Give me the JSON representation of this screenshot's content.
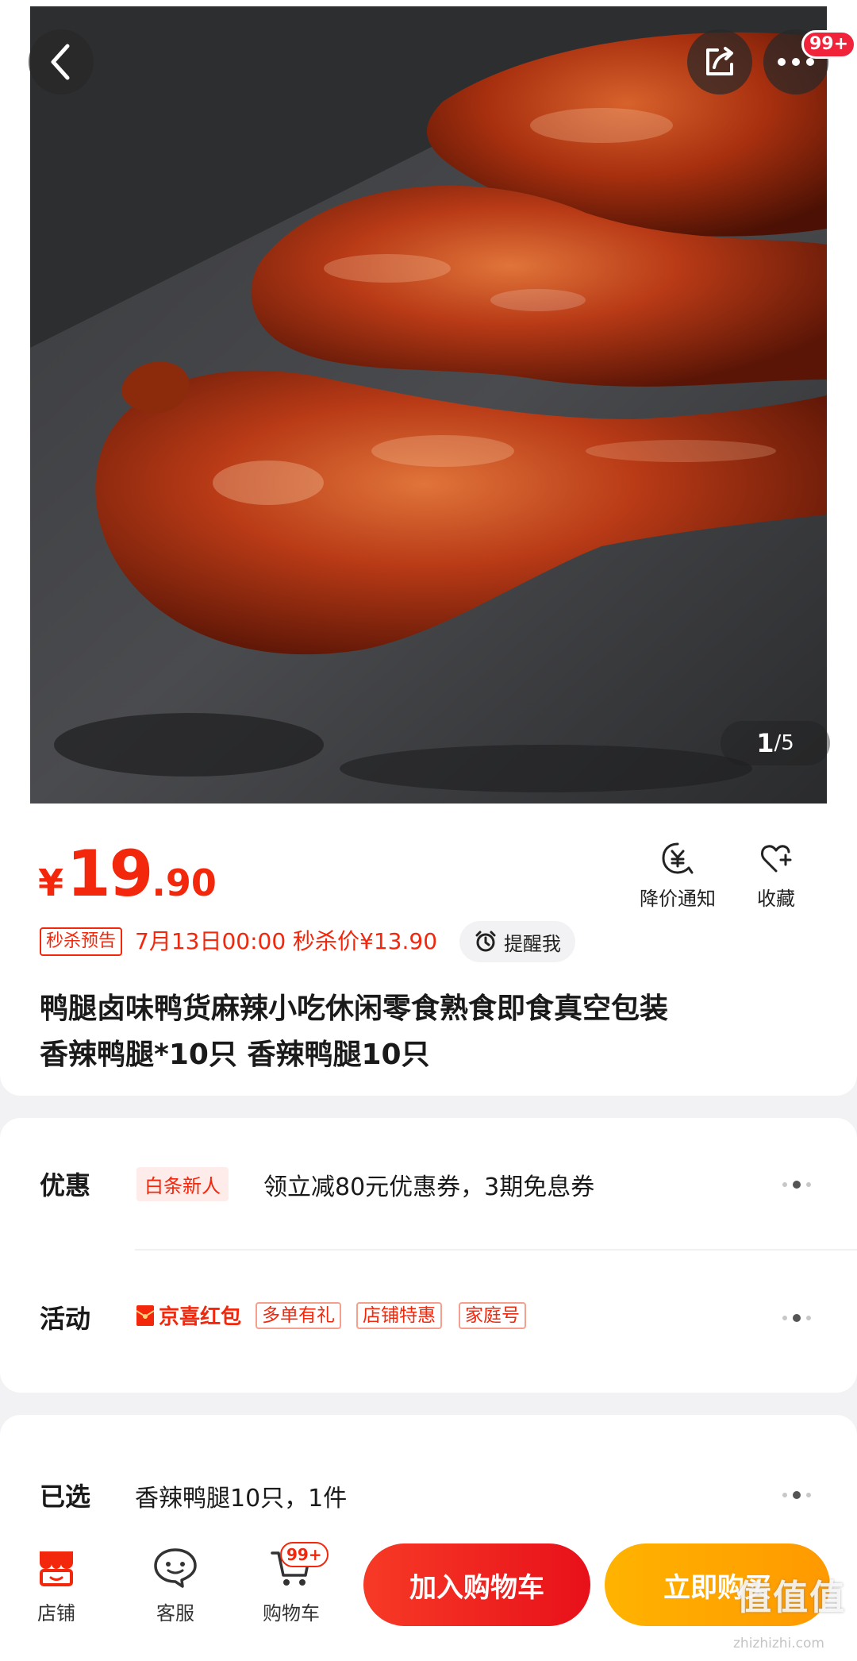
{
  "gallery": {
    "current": "1",
    "separator": "/",
    "total": "5"
  },
  "header": {
    "more_badge": "99+"
  },
  "price": {
    "currency": "¥",
    "integer": "19",
    "decimal": ".90"
  },
  "actions": {
    "notify_label": "降价通知",
    "favorite_label": "收藏"
  },
  "flash_sale": {
    "tag": "秒杀预告",
    "text": "7月13日00:00 秒杀价¥13.90",
    "remind_label": "提醒我"
  },
  "product": {
    "title_line1": "鸭腿卤味鸭货麻辣小吃休闲零食熟食即食真空包装",
    "title_line2": "香辣鸭腿*10只 香辣鸭腿10只"
  },
  "promo": {
    "discount_label": "优惠",
    "discount_tag": "白条新人",
    "discount_text": "领立减80元优惠券，3期免息券",
    "activity_label": "活动",
    "activity_brand": "京喜红包",
    "activity_tags": [
      "多单有礼",
      "店铺特惠",
      "家庭号"
    ]
  },
  "selected": {
    "label": "已选",
    "value": "香辣鸭腿10只，1件"
  },
  "bottom_bar": {
    "shop_label": "店铺",
    "service_label": "客服",
    "cart_label": "购物车",
    "cart_badge": "99+",
    "add_to_cart_label": "加入购物车",
    "buy_now_label": "立即购买"
  },
  "watermark": {
    "main": "值值值",
    "sub": "zhizhizhi.com"
  },
  "colors": {
    "accent_red": "#f2270c",
    "buy_orange": "#ff9900"
  },
  "icons": [
    "back-arrow-icon",
    "share-icon",
    "more-icon",
    "price-drop-icon",
    "heart-plus-icon",
    "alarm-clock-icon",
    "red-envelope-icon",
    "shop-icon",
    "service-icon",
    "cart-icon"
  ]
}
